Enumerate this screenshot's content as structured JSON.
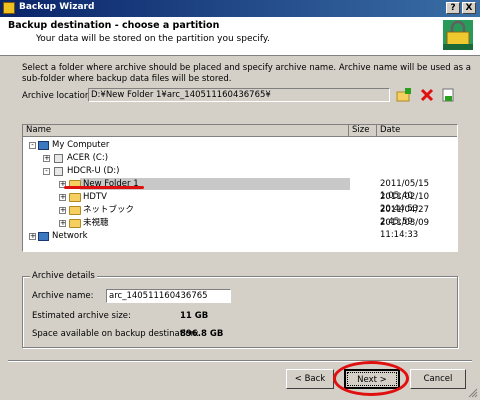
{
  "window": {
    "title": "Backup Wizard",
    "help_glyph": "?",
    "close_glyph": "X"
  },
  "header": {
    "title": "Backup destination - choose a partition",
    "subtitle": "Your data will be stored on the partition you specify."
  },
  "description": "Select a folder where archive should be placed and specify archive name. Archive name will be used as a sub-folder where backup data files will be stored.",
  "archive_location": {
    "label": "Archive location:",
    "value": "D:¥New Folder 1¥arc_140511160436765¥"
  },
  "toolbar_icons": [
    "new-folder-icon",
    "delete-icon",
    "properties-icon"
  ],
  "tree": {
    "columns": [
      "Name",
      "Size",
      "Date"
    ],
    "nodes": {
      "my_computer": "My Computer",
      "acer": "ACER (C:)",
      "hdcr": "HDCR-U (D:)",
      "folder1": {
        "name": "New Folder 1",
        "date": "2011/05/15 1:05:40"
      },
      "folder2": {
        "name": "HDTV",
        "date": "2011/02/10 20:44:53"
      },
      "folder3": {
        "name": "ネットブック",
        "date": "2011/04/27 2:45:59"
      },
      "folder4": {
        "name": "未視聴",
        "date": "2011/03/09 11:14:33"
      },
      "network": "Network"
    }
  },
  "details": {
    "group_title": "Archive details",
    "name_label": "Archive name:",
    "name_value": "arc_140511160436765",
    "size_label": "Estimated archive size:",
    "size_value": "11 GB",
    "space_label": "Space available on backup destination:",
    "space_value": "896.8 GB"
  },
  "buttons": {
    "back": "< Back",
    "next": "Next >",
    "cancel": "Cancel"
  },
  "colors": {
    "titlebar": "#0a246a",
    "dialog_bg": "#d4d0c8",
    "annotation_red": "#e01010"
  }
}
